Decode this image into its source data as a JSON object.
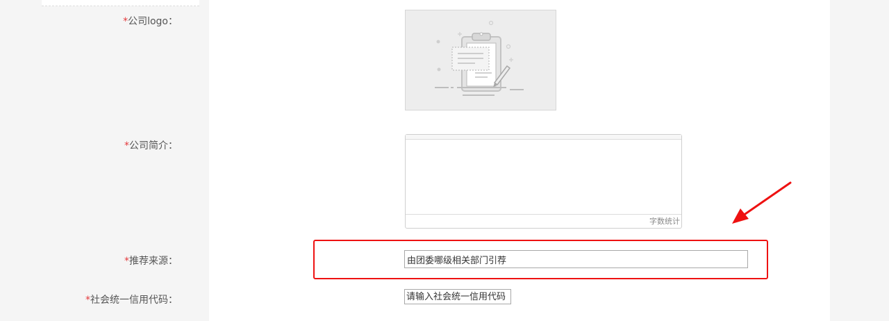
{
  "form": {
    "required_mark": "*",
    "logo_label": "公司logo：",
    "intro_label": "公司简介：",
    "intro_word_count": "字数统计",
    "source_label": "推荐来源：",
    "source_value": "由团委哪级相关部门引荐",
    "credit_label": "社会统一信用代码：",
    "credit_placeholder": "请输入社会统一信用代码"
  },
  "annotation": {
    "highlight_color": "#ee1111"
  },
  "colors": {
    "required": "#e4393c",
    "label_text": "#555555"
  },
  "icons": {
    "logo_placeholder": "clipboard-edit-icon",
    "annotation": "red-arrow-icon"
  }
}
